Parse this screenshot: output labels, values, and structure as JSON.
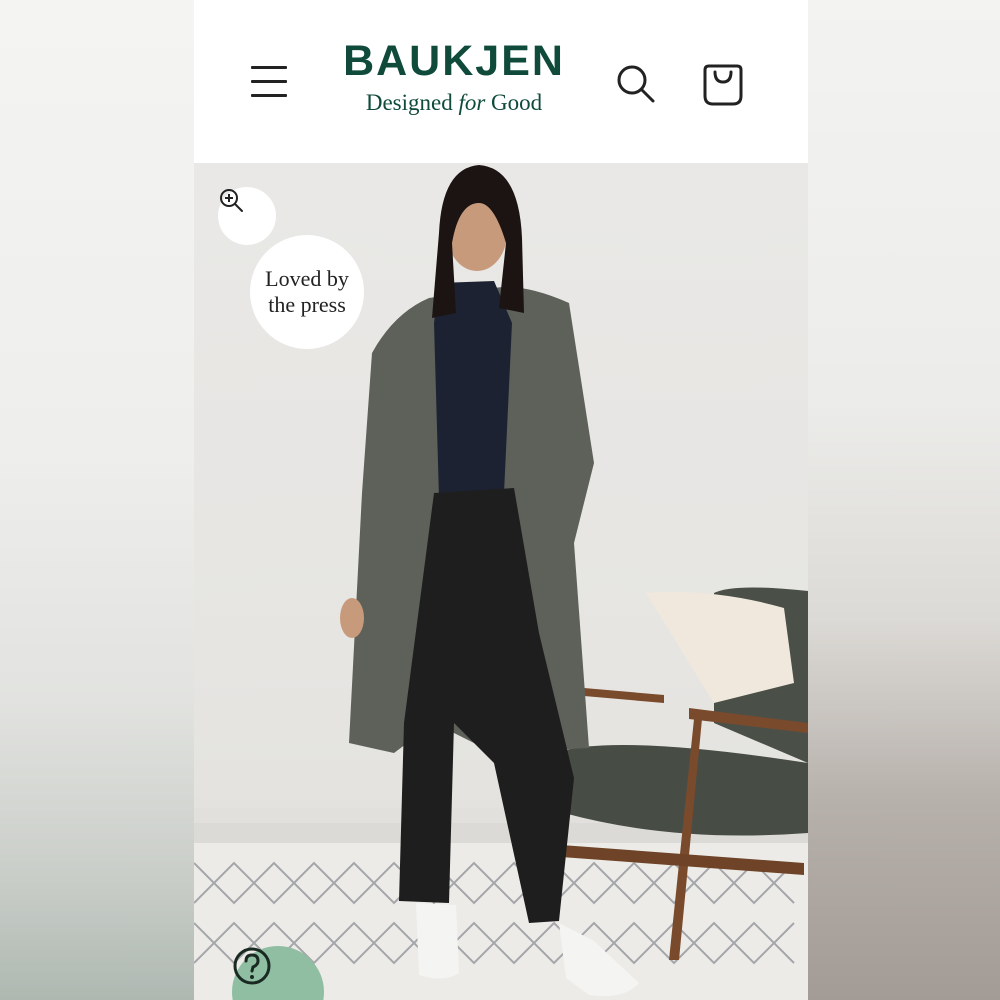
{
  "header": {
    "brand_name": "BAUKJEN",
    "tagline_start": "Designed ",
    "tagline_for": "for",
    "tagline_end": " Good",
    "brand_color": "#0f4a3a",
    "menu_icon": "hamburger-menu-icon",
    "search_icon": "search-icon",
    "bag_icon": "shopping-bag-icon"
  },
  "hero": {
    "zoom_icon": "zoom-in-icon",
    "badge_line1": "Loved by",
    "badge_line2": "the press",
    "help_icon": "question-mark-icon",
    "help_color": "#8fbea2"
  }
}
